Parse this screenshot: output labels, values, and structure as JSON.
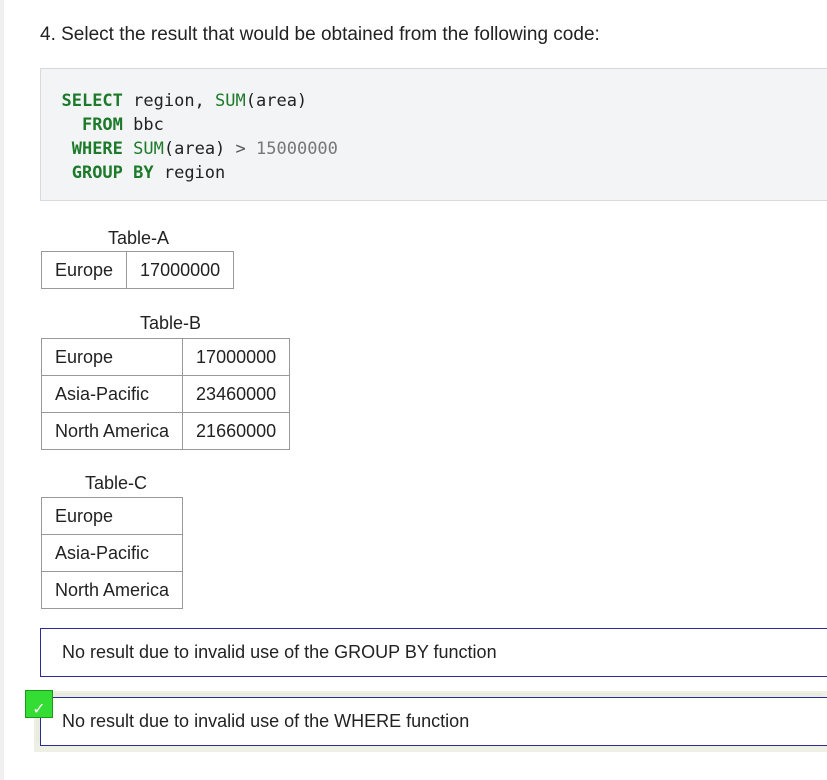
{
  "question": {
    "text": "4. Select the result that would be obtained from the following code:"
  },
  "code": {
    "line1": {
      "kw1": "SELECT",
      "t1": " region, ",
      "fn1": "SUM",
      "t2": "(area)"
    },
    "line2": {
      "kw1": "FROM",
      "t1": " bbc"
    },
    "line3": {
      "kw1": "WHERE",
      "t1": " ",
      "fn1": "SUM",
      "t2": "(area) ",
      "op": ">",
      "num": " 15000000"
    },
    "line4": {
      "kw1": "GROUP BY",
      "t1": " region"
    }
  },
  "table_a": {
    "caption": "Table-A",
    "rows": [
      [
        "Europe",
        "17000000"
      ]
    ]
  },
  "table_b": {
    "caption": "Table-B",
    "rows": [
      [
        "Europe",
        "17000000"
      ],
      [
        "Asia-Pacific",
        "23460000"
      ],
      [
        "North America",
        "21660000"
      ]
    ]
  },
  "table_c": {
    "caption": "Table-C",
    "rows": [
      [
        "Europe"
      ],
      [
        "Asia-Pacific"
      ],
      [
        "North America"
      ]
    ]
  },
  "options": {
    "group_by": "No result due to invalid use of the GROUP BY function",
    "where": "No result due to invalid use of the WHERE function"
  },
  "check_mark": "✓",
  "colors": {
    "keyword": "#1c7a2a",
    "option_border": "#2b2b9a",
    "check_bg": "#33dd33"
  }
}
